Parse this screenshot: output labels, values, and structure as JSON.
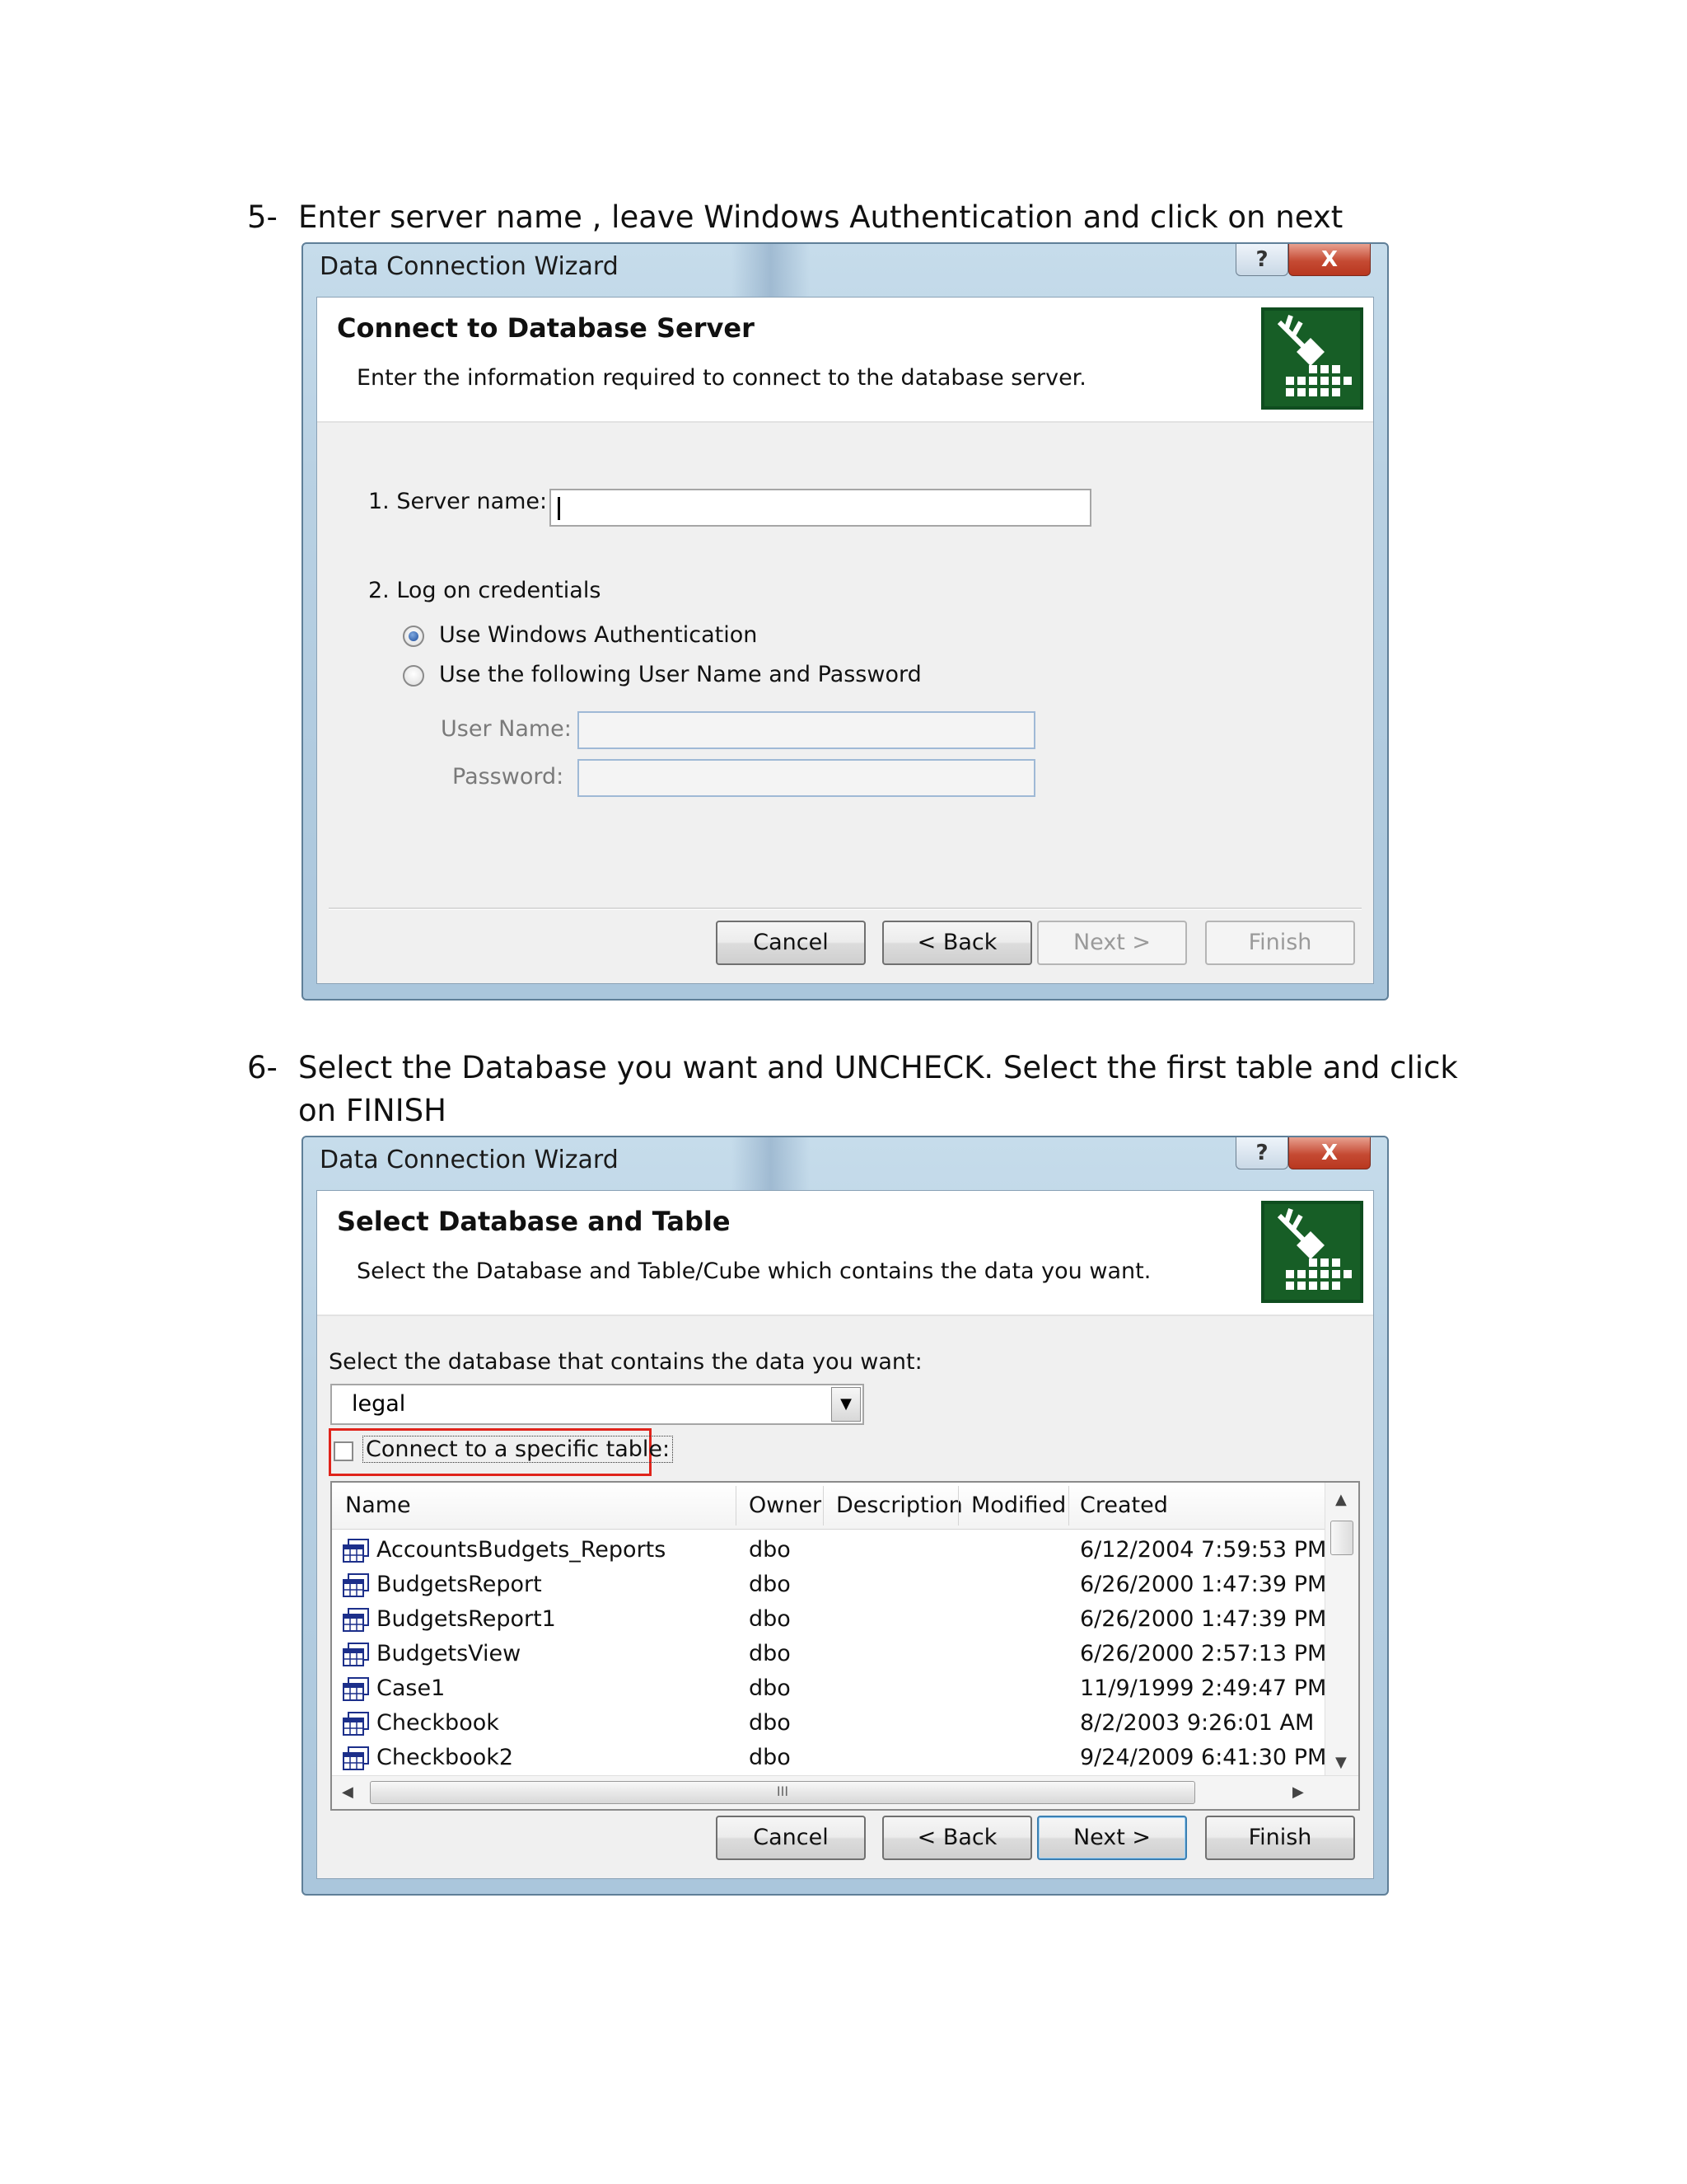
{
  "steps": [
    {
      "number": "5-",
      "text": "Enter server name , leave Windows Authentication and click on next"
    },
    {
      "number": "6-",
      "text": "Select the Database you want and UNCHECK. Select the first table and click on FINISH"
    }
  ],
  "dialog1": {
    "window_title": "Data Connection Wizard",
    "help_glyph": "?",
    "close_glyph": "X",
    "header_title": "Connect to Database Server",
    "header_desc": "Enter the information required to connect to the database server.",
    "server_label": "1. Server name:",
    "server_value": "",
    "credentials_label": "2. Log on credentials",
    "radio_windows": "Use Windows Authentication",
    "radio_user": "Use the following User Name and Password",
    "username_label": "User Name:",
    "password_label": "Password:",
    "buttons": {
      "cancel": "Cancel",
      "back": "< Back",
      "next": "Next >",
      "finish": "Finish"
    }
  },
  "dialog2": {
    "window_title": "Data Connection Wizard",
    "help_glyph": "?",
    "close_glyph": "X",
    "header_title": "Select Database and Table",
    "header_desc": "Select the Database and Table/Cube which contains the data you want.",
    "db_label": "Select the database that contains the data you want:",
    "db_selected": "legal",
    "combo_arrow": "▼",
    "checkbox_label": "Connect to a specific table:",
    "columns": [
      "Name",
      "Owner",
      "Description",
      "Modified",
      "Created"
    ],
    "rows": [
      [
        "AccountsBudgets_Reports",
        "dbo",
        "",
        "",
        "6/12/2004 7:59:53 PM"
      ],
      [
        "BudgetsReport",
        "dbo",
        "",
        "",
        "6/26/2000 1:47:39 PM"
      ],
      [
        "BudgetsReport1",
        "dbo",
        "",
        "",
        "6/26/2000 1:47:39 PM"
      ],
      [
        "BudgetsView",
        "dbo",
        "",
        "",
        "6/26/2000 2:57:13 PM"
      ],
      [
        "Case1",
        "dbo",
        "",
        "",
        "11/9/1999 2:49:47 PM"
      ],
      [
        "Checkbook",
        "dbo",
        "",
        "",
        "8/2/2003 9:26:01 AM"
      ],
      [
        "Checkbook2",
        "dbo",
        "",
        "",
        "9/24/2009 6:41:30 PM"
      ]
    ],
    "scroll_glyphs": {
      "up": "▲",
      "down": "▼",
      "left": "◀",
      "right": "▶",
      "grip": "III"
    },
    "buttons": {
      "cancel": "Cancel",
      "back": "< Back",
      "next": "Next >",
      "finish": "Finish"
    }
  },
  "icons": {
    "wizard": "database-plug-icon",
    "table": "table-icon"
  },
  "colors": {
    "highlight_box": "#e0241b",
    "default_button": "#3c7fb1",
    "titlebar": "#b9d1e3",
    "close_button": "#c54a33"
  }
}
